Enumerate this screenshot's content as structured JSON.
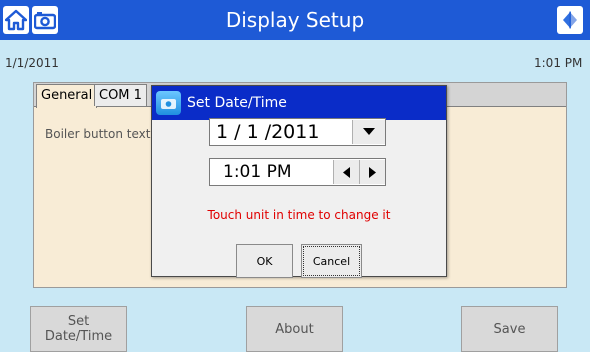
{
  "titlebar": {
    "title": "Display Setup",
    "left_icons": [
      "home-icon",
      "camera-icon"
    ],
    "right_icon": "back-icon"
  },
  "status": {
    "date": "1/1/2011",
    "time": "1:01 PM"
  },
  "panel": {
    "tabs": [
      "General",
      "COM 1"
    ],
    "field_label": "Boiler button text"
  },
  "dialog": {
    "title": "Set Date/Time",
    "date_value": "1 / 1 /2011",
    "time_value": "1:01 PM",
    "hint": "Touch unit in time to change it",
    "ok_label": "OK",
    "cancel_label": "Cancel"
  },
  "buttons": {
    "set_date_line1": "Set",
    "set_date_line2": "Date/Time",
    "about": "About",
    "save": "Save"
  },
  "colors": {
    "titlebar": "#1e5ad6",
    "dialog_title": "#0a2cc8",
    "background": "#c9e8f5",
    "panel": "#f8ecd6",
    "hint_text": "#e00000"
  }
}
